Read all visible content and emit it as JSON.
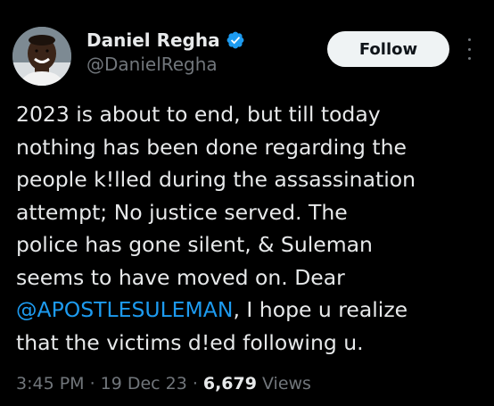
{
  "author": {
    "display_name": "Daniel Regha",
    "handle": "@DanielRegha",
    "verified": true,
    "verified_color": "#1d9bf0",
    "avatar_icon": "profile-photo"
  },
  "actions": {
    "follow_label": "Follow",
    "more_icon": "vertical-ellipsis-icon"
  },
  "tweet": {
    "lines": [
      "2023 is about to end, but till today",
      "nothing has been done regarding the",
      "people k!lled during the assassination",
      "attempt; No justice served. The",
      "police has gone silent, & Suleman",
      "seems to have moved on. Dear"
    ],
    "mention": "@APOSTLESULEMAN",
    "line7_rest": ", I hope u realize",
    "line8": "that the victims d!ed following u."
  },
  "meta": {
    "time": "3:45 PM",
    "separator": "·",
    "date": "19 Dec 23",
    "views_count": "6,679",
    "views_label": "Views"
  },
  "colors": {
    "background": "#000000",
    "text": "#e7e9ea",
    "secondary": "#71767b",
    "link": "#1d9bf0",
    "follow_bg": "#eff3f4"
  }
}
